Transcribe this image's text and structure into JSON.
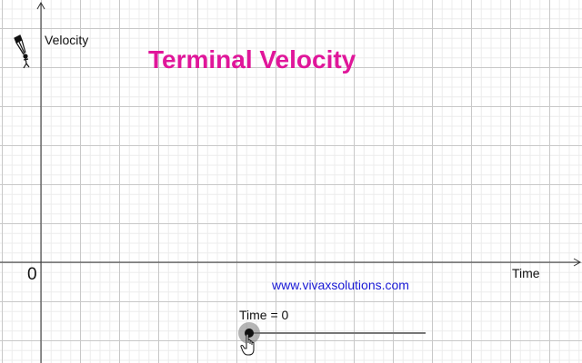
{
  "title": "Terminal Velocity",
  "axes": {
    "y_label": "Velocity",
    "x_label": "Time",
    "origin_label": "0"
  },
  "website": "www.vivaxsolutions.com",
  "slider": {
    "label": "Time = 0",
    "value": 0
  },
  "colors": {
    "title": "#e0169a",
    "link": "#1a1ad6",
    "grid_major": "#c8c8c8",
    "grid_minor": "#ececec"
  },
  "icons": {
    "skydiver": "skydiver-icon",
    "cursor": "hand-pointer-icon"
  }
}
